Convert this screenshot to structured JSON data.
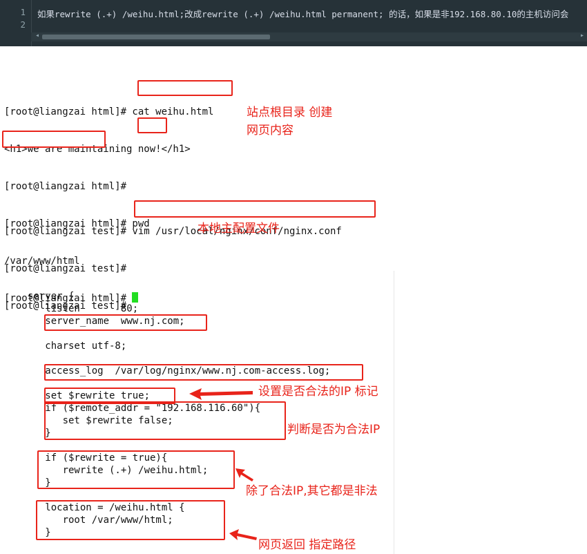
{
  "editor": {
    "line_numbers": [
      "1",
      "2"
    ],
    "line1": "如果rewrite (.+) /weihu.html;改成rewrite (.+) /weihu.html permanent; 的话，如果是非192.168.80.10的主机访问会",
    "scroll_left": "◂",
    "scroll_right": "▸"
  },
  "terminal1": {
    "lines": [
      "[root@liangzai html]# cat weihu.html",
      "<h1>we are maintaining now!</h1>",
      "[root@liangzai html]#",
      "[root@liangzai html]# pwd",
      "/var/www/html",
      "[root@liangzai html]# "
    ],
    "note": "站点根目录 创建\n网页内容"
  },
  "terminal2": {
    "lines": [
      "[root@liangzai test]# vim /usr/local/nginx/conf/nginx.conf",
      "[root@liangzai test]#",
      "[root@liangzai test]#"
    ],
    "note": "本地主配置文件"
  },
  "config": {
    "lines": [
      "server {",
      "   listen       80;",
      "   server_name  www.nj.com;",
      "",
      "   charset utf-8;",
      "",
      "   access_log  /var/log/nginx/www.nj.com-access.log;",
      "",
      "   set $rewrite true;",
      "   if ($remote_addr = \"192.168.116.60\"){",
      "      set $rewrite false;",
      "   }",
      "",
      "   if ($rewrite = true){",
      "      rewrite (.+) /weihu.html;",
      "   }",
      "",
      "   location = /weihu.html {",
      "      root /var/www/html;",
      "   }"
    ],
    "notes": {
      "flag": "设置是否合法的IP 标记",
      "check": "判断是否为合法IP",
      "illegal": "除了合法IP,其它都是非法",
      "return": "网页返回 指定路径"
    }
  },
  "colors": {
    "annotation": "#e8231a",
    "cursor": "#22dd22",
    "editor_bg": "#263238"
  }
}
